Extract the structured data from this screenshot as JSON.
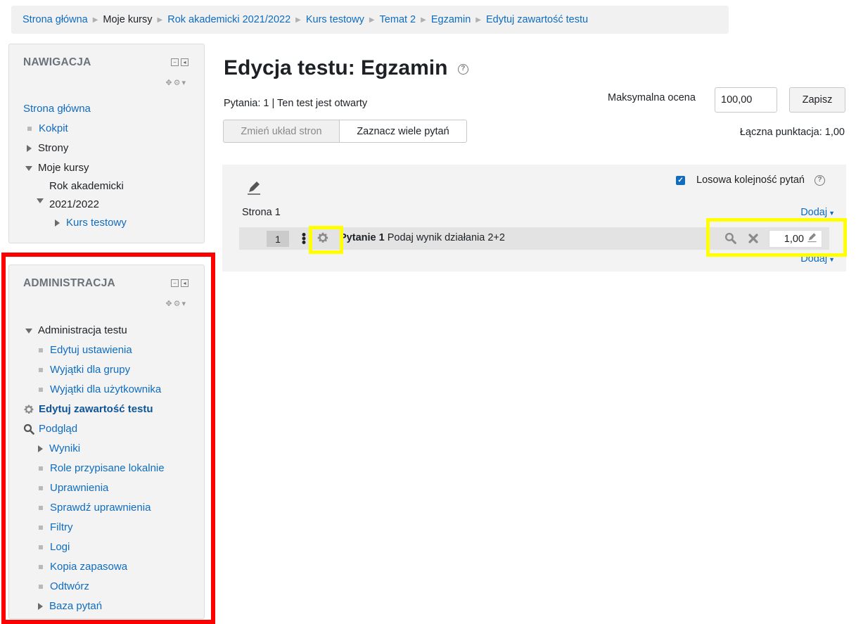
{
  "breadcrumb": [
    {
      "label": "Strona główna",
      "link": true
    },
    {
      "label": "Moje kursy",
      "link": false
    },
    {
      "label": "Rok akademicki 2021/2022",
      "link": true
    },
    {
      "label": "Kurs testowy",
      "link": true
    },
    {
      "label": "Temat 2",
      "link": true
    },
    {
      "label": "Egzamin",
      "link": true
    },
    {
      "label": "Edytuj zawartość testu",
      "link": true
    }
  ],
  "nav_block": {
    "title": "NAWIGACJA",
    "home": "Strona główna",
    "dashboard": "Kokpit",
    "pages": "Strony",
    "my_courses": "Moje kursy",
    "year_line1": "Rok akademicki",
    "year_line2": "2021/2022",
    "course": "Kurs testowy"
  },
  "admin_block": {
    "title": "ADMINISTRACJA",
    "root": "Administracja testu",
    "items": [
      {
        "label": "Edytuj ustawienia",
        "icon": "bullet"
      },
      {
        "label": "Wyjątki dla grupy",
        "icon": "bullet"
      },
      {
        "label": "Wyjątki dla użytkownika",
        "icon": "bullet"
      },
      {
        "label": "Edytuj zawartość testu",
        "icon": "gear-icon",
        "active": true
      },
      {
        "label": "Podgląd",
        "icon": "magnifier-icon"
      },
      {
        "label": "Wyniki",
        "icon": "expand-triangle"
      },
      {
        "label": "Role przypisane lokalnie",
        "icon": "bullet"
      },
      {
        "label": "Uprawnienia",
        "icon": "bullet"
      },
      {
        "label": "Sprawdź uprawnienia",
        "icon": "bullet"
      },
      {
        "label": "Filtry",
        "icon": "bullet"
      },
      {
        "label": "Logi",
        "icon": "bullet"
      },
      {
        "label": "Kopia zapasowa",
        "icon": "bullet"
      },
      {
        "label": "Odtwórz",
        "icon": "bullet"
      },
      {
        "label": "Baza pytań",
        "icon": "expand-triangle"
      }
    ]
  },
  "main": {
    "title": "Edycja testu: Egzamin",
    "status": "Pytania: 1 | Ten test jest otwarty",
    "repaginate_label": "Zmień układ stron",
    "select_multiple_label": "Zaznacz wiele pytań",
    "max_grade_label": "Maksymalna ocena",
    "max_grade_value": "100,00",
    "save_label": "Zapisz",
    "total_marks": "Łączna punktacja: 1,00",
    "shuffle_label": "Losowa kolejność pytań",
    "shuffle_checked": true,
    "page_label": "Strona 1",
    "add_label": "Dodaj",
    "question": {
      "number": "1",
      "name": "Pytanie 1",
      "text": "Podaj wynik działania 2+2",
      "mark": "1,00"
    }
  },
  "colors": {
    "link": "#0f6cbf",
    "highlight_red": "#ff0000",
    "highlight_yellow": "#ffff00"
  }
}
